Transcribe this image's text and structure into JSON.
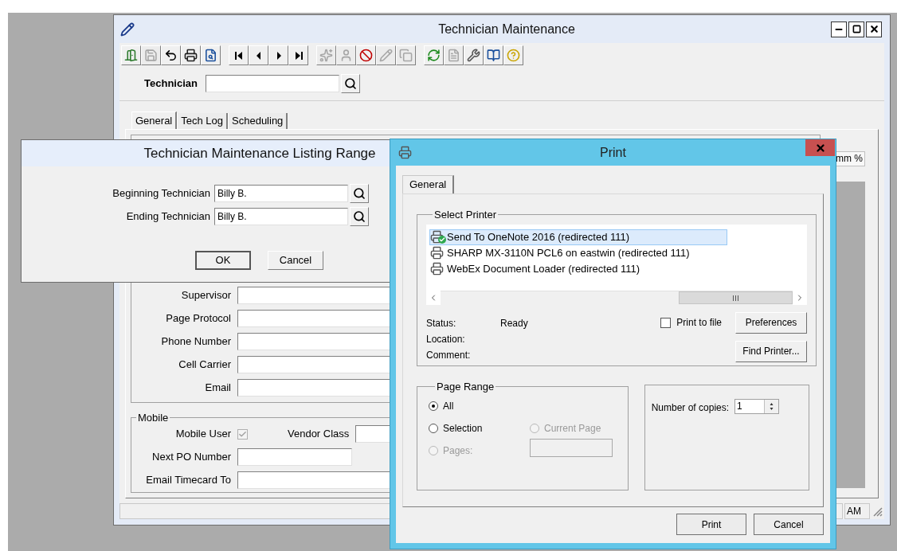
{
  "main_window": {
    "title": "Technician Maintenance",
    "toolbar": [
      [
        {
          "disabled": false
        },
        {
          "disabled": true
        },
        {
          "disabled": false
        },
        {
          "disabled": false
        },
        {
          "disabled": false
        }
      ],
      [
        {
          "disabled": false
        },
        {
          "disabled": false
        },
        {
          "disabled": false
        },
        {
          "disabled": false
        }
      ],
      [
        {
          "disabled": true
        },
        {
          "disabled": true
        },
        {
          "disabled": false
        },
        {
          "disabled": true
        },
        {
          "disabled": true
        }
      ],
      [
        {
          "disabled": false
        },
        {
          "disabled": true
        },
        {
          "disabled": false
        },
        {
          "disabled": false
        },
        {
          "disabled": false
        }
      ]
    ],
    "search_label": "Technician",
    "tabs": [
      {
        "label": "General",
        "selected": true
      },
      {
        "label": "Tech Log",
        "selected": false
      },
      {
        "label": "Scheduling",
        "selected": false
      }
    ],
    "fields": [
      {
        "label": "Supervisor"
      },
      {
        "label": "Page Protocol"
      },
      {
        "label": "Phone Number"
      },
      {
        "label": "Cell Carrier"
      },
      {
        "label": "Email"
      }
    ],
    "mobile": {
      "legend": "Mobile",
      "mobile_user": {
        "label": "Mobile User",
        "checked": true,
        "disabled": true
      },
      "vendor_class": "Vendor Class",
      "next_po": "Next PO Number",
      "email_timecard": "Email Timecard To"
    },
    "column_header": "mm %",
    "status_time": "AM"
  },
  "listing_dialog": {
    "title": "Technician Maintenance Listing Range",
    "fields": [
      {
        "label": "Beginning Technician",
        "value": "Billy B."
      },
      {
        "label": "Ending Technician",
        "value": "Billy B."
      }
    ],
    "buttons": [
      {
        "label": "OK",
        "default": true
      },
      {
        "label": "Cancel",
        "default": false
      }
    ]
  },
  "print_dialog": {
    "title": "Print",
    "tab": {
      "label": "General",
      "selected": true
    },
    "select_printer": {
      "legend": "Select Printer",
      "printers": [
        {
          "name": "Send To OneNote 2016 (redirected 111)",
          "selected": true,
          "default": true
        },
        {
          "name": "SHARP MX-3110N PCL6 on eastwin (redirected 111)",
          "selected": false,
          "default": false
        },
        {
          "name": "WebEx Document Loader (redirected 111)",
          "selected": false,
          "default": false
        }
      ],
      "info": [
        {
          "label": "Status:",
          "value": "Ready"
        },
        {
          "label": "Location:"
        },
        {
          "label": "Comment:"
        }
      ],
      "print_to_file": {
        "label": "Print to file",
        "checked": false
      },
      "buttons": [
        "Preferences",
        "Find Printer..."
      ]
    },
    "page_range": {
      "legend": "Page Range",
      "options": [
        {
          "label": "All",
          "selected": true,
          "disabled": false
        },
        {
          "label": "Selection",
          "selected": false,
          "disabled": false
        },
        {
          "label": "Current Page",
          "selected": false,
          "disabled": true
        },
        {
          "label": "Pages:",
          "selected": false,
          "disabled": true
        }
      ]
    },
    "copies": {
      "label": "Number of copies:",
      "value": "1"
    },
    "buttons": [
      "Print",
      "Cancel"
    ]
  }
}
